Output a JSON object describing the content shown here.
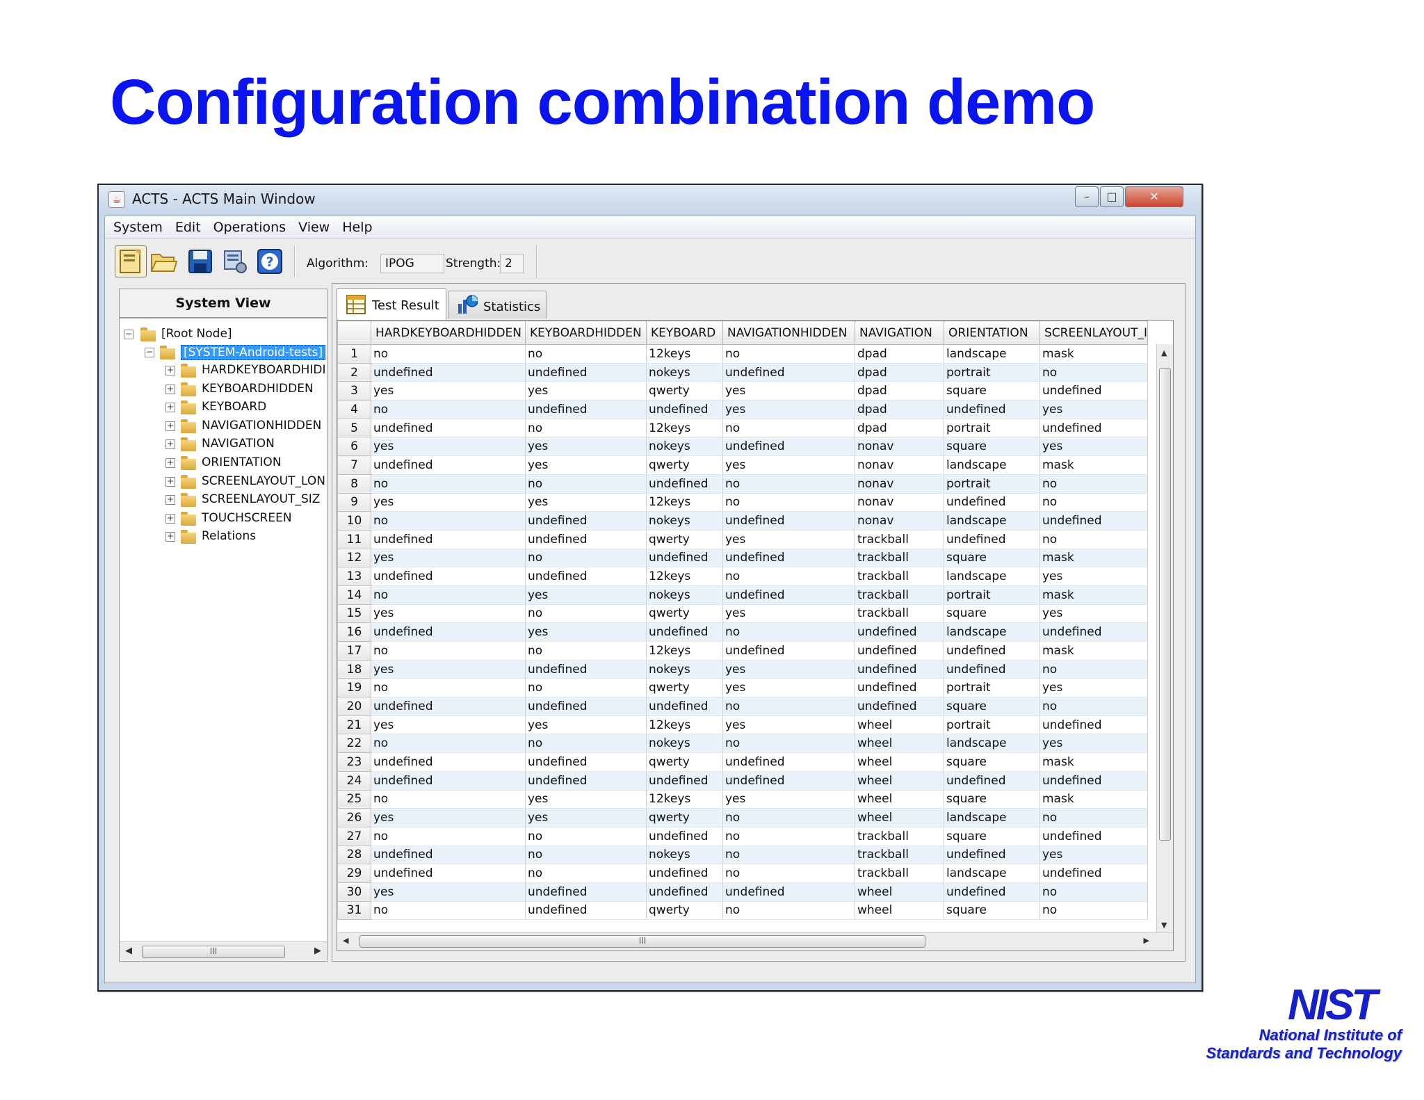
{
  "slide": {
    "title": "Configuration combination demo"
  },
  "window": {
    "title": "ACTS - ACTS Main Window",
    "controls": {
      "minimize": "–",
      "maximize": "□",
      "close": "✕"
    }
  },
  "menu": [
    "System",
    "Edit",
    "Operations",
    "View",
    "Help"
  ],
  "toolbar": {
    "icons": [
      "new-system-icon",
      "open-folder-icon",
      "save-disk-icon",
      "build-settings-icon",
      "help-icon"
    ],
    "algorithm_label": "Algorithm:",
    "algorithm_value": "IPOG",
    "strength_label": "Strength:",
    "strength_value": "2"
  },
  "system_view": {
    "header": "System View",
    "root": "[Root Node]",
    "system": "[SYSTEM-Android-tests]",
    "parameters": [
      "HARDKEYBOARDHIDI",
      "KEYBOARDHIDDEN",
      "KEYBOARD",
      "NAVIGATIONHIDDEN",
      "NAVIGATION",
      "ORIENTATION",
      "SCREENLAYOUT_LON",
      "SCREENLAYOUT_SIZ",
      "TOUCHSCREEN",
      "Relations"
    ],
    "scroll_grip": "III"
  },
  "tabs": [
    {
      "label": "Test Result",
      "active": true
    },
    {
      "label": "Statistics",
      "active": false
    }
  ],
  "table": {
    "columns": [
      "HARDKEYBOARDHIDDEN",
      "KEYBOARDHIDDEN",
      "KEYBOARD",
      "NAVIGATIONHIDDEN",
      "NAVIGATION",
      "ORIENTATION",
      "SCREENLAYOUT_I"
    ],
    "rows": [
      [
        "1",
        "no",
        "no",
        "12keys",
        "no",
        "dpad",
        "landscape",
        "mask"
      ],
      [
        "2",
        "undefined",
        "undefined",
        "nokeys",
        "undefined",
        "dpad",
        "portrait",
        "no"
      ],
      [
        "3",
        "yes",
        "yes",
        "qwerty",
        "yes",
        "dpad",
        "square",
        "undefined"
      ],
      [
        "4",
        "no",
        "undefined",
        "undefined",
        "yes",
        "dpad",
        "undefined",
        "yes"
      ],
      [
        "5",
        "undefined",
        "no",
        "12keys",
        "no",
        "dpad",
        "portrait",
        "undefined"
      ],
      [
        "6",
        "yes",
        "yes",
        "nokeys",
        "undefined",
        "nonav",
        "square",
        "yes"
      ],
      [
        "7",
        "undefined",
        "yes",
        "qwerty",
        "yes",
        "nonav",
        "landscape",
        "mask"
      ],
      [
        "8",
        "no",
        "no",
        "undefined",
        "no",
        "nonav",
        "portrait",
        "no"
      ],
      [
        "9",
        "yes",
        "yes",
        "12keys",
        "no",
        "nonav",
        "undefined",
        "no"
      ],
      [
        "10",
        "no",
        "undefined",
        "nokeys",
        "undefined",
        "nonav",
        "landscape",
        "undefined"
      ],
      [
        "11",
        "undefined",
        "undefined",
        "qwerty",
        "yes",
        "trackball",
        "undefined",
        "no"
      ],
      [
        "12",
        "yes",
        "no",
        "undefined",
        "undefined",
        "trackball",
        "square",
        "mask"
      ],
      [
        "13",
        "undefined",
        "undefined",
        "12keys",
        "no",
        "trackball",
        "landscape",
        "yes"
      ],
      [
        "14",
        "no",
        "yes",
        "nokeys",
        "undefined",
        "trackball",
        "portrait",
        "mask"
      ],
      [
        "15",
        "yes",
        "no",
        "qwerty",
        "yes",
        "trackball",
        "square",
        "yes"
      ],
      [
        "16",
        "undefined",
        "yes",
        "undefined",
        "no",
        "undefined",
        "landscape",
        "undefined"
      ],
      [
        "17",
        "no",
        "no",
        "12keys",
        "undefined",
        "undefined",
        "undefined",
        "mask"
      ],
      [
        "18",
        "yes",
        "undefined",
        "nokeys",
        "yes",
        "undefined",
        "undefined",
        "no"
      ],
      [
        "19",
        "no",
        "no",
        "qwerty",
        "yes",
        "undefined",
        "portrait",
        "yes"
      ],
      [
        "20",
        "undefined",
        "undefined",
        "undefined",
        "no",
        "undefined",
        "square",
        "no"
      ],
      [
        "21",
        "yes",
        "yes",
        "12keys",
        "yes",
        "wheel",
        "portrait",
        "undefined"
      ],
      [
        "22",
        "no",
        "no",
        "nokeys",
        "no",
        "wheel",
        "landscape",
        "yes"
      ],
      [
        "23",
        "undefined",
        "undefined",
        "qwerty",
        "undefined",
        "wheel",
        "square",
        "mask"
      ],
      [
        "24",
        "undefined",
        "undefined",
        "undefined",
        "undefined",
        "wheel",
        "undefined",
        "undefined"
      ],
      [
        "25",
        "no",
        "yes",
        "12keys",
        "yes",
        "wheel",
        "square",
        "mask"
      ],
      [
        "26",
        "yes",
        "yes",
        "qwerty",
        "no",
        "wheel",
        "landscape",
        "no"
      ],
      [
        "27",
        "no",
        "no",
        "undefined",
        "no",
        "trackball",
        "square",
        "undefined"
      ],
      [
        "28",
        "undefined",
        "no",
        "nokeys",
        "no",
        "trackball",
        "undefined",
        "yes"
      ],
      [
        "29",
        "undefined",
        "no",
        "undefined",
        "no",
        "trackball",
        "landscape",
        "undefined"
      ],
      [
        "30",
        "yes",
        "undefined",
        "undefined",
        "undefined",
        "wheel",
        "undefined",
        "no"
      ],
      [
        "31",
        "no",
        "undefined",
        "qwerty",
        "no",
        "wheel",
        "square",
        "no"
      ]
    ]
  },
  "logo": {
    "mark": "NIST",
    "line1": "National Institute of",
    "line2": "Standards and Technology"
  },
  "colors": {
    "title_blue": "#0a14f0",
    "selection_blue": "#3399ff",
    "nist_blue": "#1620c8"
  }
}
